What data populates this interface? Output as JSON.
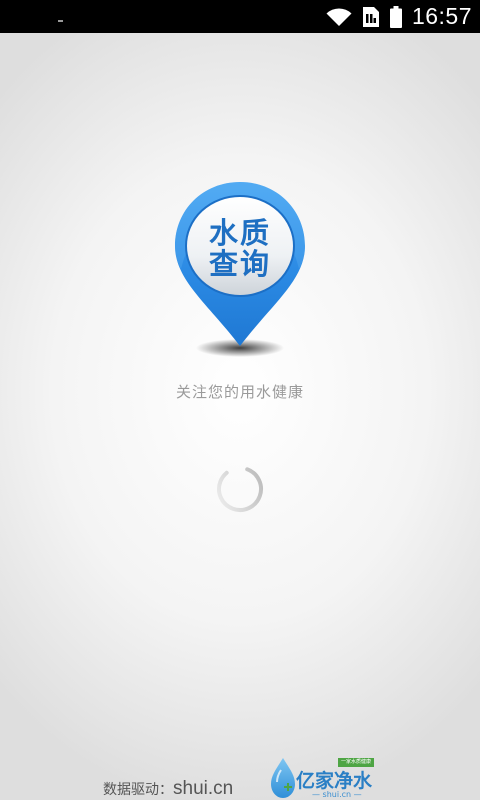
{
  "status_bar": {
    "time": "16:57",
    "icons": [
      "wifi-icon",
      "sim-icon",
      "battery-icon"
    ]
  },
  "logo": {
    "line1": "水质",
    "line2": "查询",
    "pin_color": "#2f8fe6",
    "text_color": "#1e6fc2"
  },
  "tagline": "关注您的用水健康",
  "loading": {
    "icon": "loading-spinner-icon"
  },
  "footer": {
    "credit_label": "数据驱动：",
    "credit_domain": "shui.cn",
    "brand_name_part1": "亿家",
    "brand_name_part2": "净水",
    "brand_badge": "一家水质健康",
    "brand_domain": "— shui.cn —",
    "brand_icon": "water-drop-icon"
  }
}
